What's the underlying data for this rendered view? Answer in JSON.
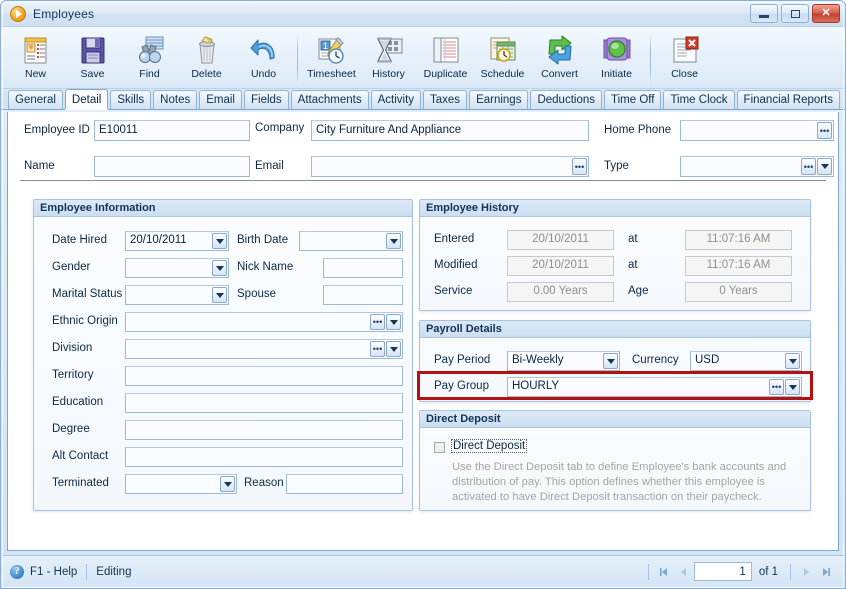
{
  "window": {
    "title": "Employees",
    "app_icon": "play-circle-icon",
    "minimize_label": "Minimize",
    "restore_label": "Restore",
    "close_label": "Close"
  },
  "toolbar": {
    "buttons": [
      {
        "label": "New",
        "icon": "new-document-icon"
      },
      {
        "label": "Save",
        "icon": "floppy-disk-icon"
      },
      {
        "label": "Find",
        "icon": "binoculars-icon"
      },
      {
        "label": "Delete",
        "icon": "trash-can-icon"
      },
      {
        "label": "Undo",
        "icon": "undo-arrow-icon"
      },
      {
        "label": "Timesheet",
        "icon": "timesheet-clock-icon"
      },
      {
        "label": "History",
        "icon": "hourglass-icon"
      },
      {
        "label": "Duplicate",
        "icon": "duplicate-pages-icon"
      },
      {
        "label": "Schedule",
        "icon": "schedule-calendar-icon"
      },
      {
        "label": "Convert",
        "icon": "convert-arrows-icon"
      },
      {
        "label": "Initiate",
        "icon": "traffic-light-icon"
      },
      {
        "label": "Close",
        "icon": "close-document-icon"
      }
    ]
  },
  "tabs": {
    "items": [
      "General",
      "Detail",
      "Skills",
      "Notes",
      "Email",
      "Fields",
      "Attachments",
      "Activity",
      "Taxes",
      "Earnings",
      "Deductions",
      "Time Off",
      "Time Clock",
      "Financial Reports"
    ],
    "selected": "Detail"
  },
  "header_fields": {
    "employee_id": {
      "label": "Employee ID",
      "value": "E10011",
      "placeholder": ""
    },
    "name": {
      "label": "Name",
      "value": "",
      "placeholder": ""
    },
    "company": {
      "label": "Company",
      "value": "City Furniture And Appliance",
      "placeholder": ""
    },
    "email": {
      "label": "Email",
      "value": "",
      "placeholder": ""
    },
    "home_phone": {
      "label": "Home Phone",
      "value": "",
      "placeholder": ""
    },
    "type": {
      "label": "Type",
      "value": "",
      "placeholder": ""
    }
  },
  "employee_information": {
    "title": "Employee Information",
    "date_hired": {
      "label": "Date Hired",
      "value": "20/10/2011"
    },
    "birth_date": {
      "label": "Birth Date",
      "value": ""
    },
    "gender": {
      "label": "Gender",
      "value": ""
    },
    "nick_name": {
      "label": "Nick Name",
      "value": ""
    },
    "marital_status": {
      "label": "Marital Status",
      "value": ""
    },
    "spouse": {
      "label": "Spouse",
      "value": ""
    },
    "ethnic_origin": {
      "label": "Ethnic Origin",
      "value": ""
    },
    "division": {
      "label": "Division",
      "value": ""
    },
    "territory": {
      "label": "Territory",
      "value": ""
    },
    "education": {
      "label": "Education",
      "value": ""
    },
    "degree": {
      "label": "Degree",
      "value": ""
    },
    "alt_contact": {
      "label": "Alt Contact",
      "value": ""
    },
    "terminated": {
      "label": "Terminated",
      "value": ""
    },
    "reason": {
      "label": "Reason",
      "value": ""
    }
  },
  "employee_history": {
    "title": "Employee History",
    "entered": {
      "label": "Entered",
      "date": "20/10/2011",
      "at_label": "at",
      "time": "11:07:16 AM"
    },
    "modified": {
      "label": "Modified",
      "date": "20/10/2011",
      "at_label": "at",
      "time": "11:07:16 AM"
    },
    "service": {
      "label": "Service",
      "value": "0.00 Years"
    },
    "age": {
      "label": "Age",
      "value": "0 Years"
    }
  },
  "payroll_details": {
    "title": "Payroll Details",
    "pay_period": {
      "label": "Pay Period",
      "value": "Bi-Weekly"
    },
    "currency": {
      "label": "Currency",
      "value": "USD"
    },
    "pay_group": {
      "label": "Pay Group",
      "value": "HOURLY"
    },
    "highlight_color": "#b5110f"
  },
  "direct_deposit": {
    "title": "Direct Deposit",
    "checkbox_label": "Direct Deposit",
    "checked": false,
    "hint": "Use the Direct Deposit tab to define Employee's bank accounts and distribution of pay. This option defines whether this employee is activated to have Direct Deposit transaction on their paycheck."
  },
  "statusbar": {
    "help_icon": "help-circle-icon",
    "help_text": "F1 - Help",
    "mode_text": "Editing",
    "nav": {
      "first": "first-record-icon",
      "prev": "previous-record-icon",
      "current_page": "1",
      "of_label": "of 1",
      "next": "next-record-icon",
      "last": "last-record-icon"
    }
  }
}
